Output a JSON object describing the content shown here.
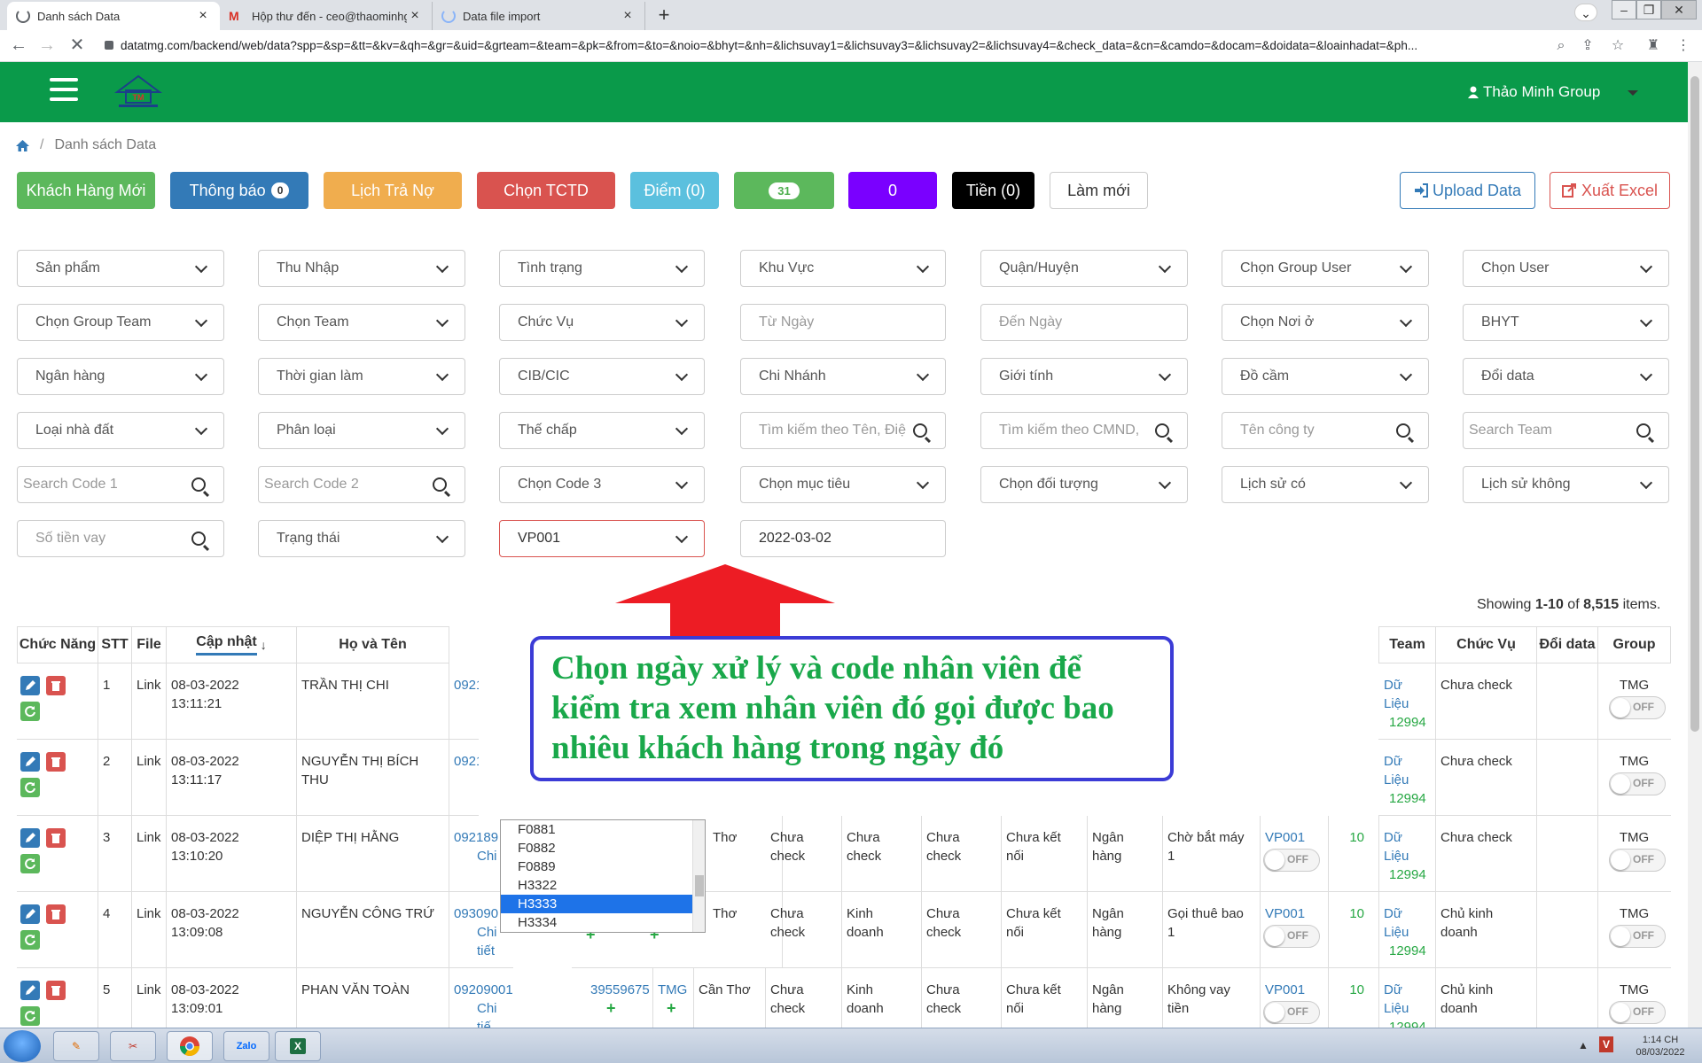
{
  "browser": {
    "tabs": [
      {
        "title": "Danh sách Data"
      },
      {
        "title": "Hộp thư đến - ceo@thaominhgro"
      },
      {
        "title": "Data file import"
      }
    ],
    "new_tab": "+",
    "url": "datatmg.com/backend/web/data?spp=&sp=&tt=&kv=&qh=&gr=&uid=&grteam=&team=&pk=&from=&to=&noio=&bhyt=&nh=&lichsuvay1=&lichsuvay3=&lichsuvay2=&lichsuvay4=&check_data=&cn=&camdo=&docam=&doidata=&loainhadat=&ph..."
  },
  "header": {
    "user_name": "Thảo Minh Group"
  },
  "breadcrumb": {
    "current": "Danh sách Data",
    "separator": "/"
  },
  "actions": {
    "new_customer": "Khách Hàng Mới",
    "notification": "Thông báo",
    "notification_count": "0",
    "payment_schedule": "Lịch Trả Nợ",
    "choose_tctd": "Chọn TCTD",
    "points": "Điểm (0)",
    "green_count": "31",
    "purple_count": "0",
    "money": "Tiền (0)",
    "refresh": "Làm mới",
    "upload": "Upload Data",
    "export": "Xuất Excel",
    "colors": {
      "green": "#5cb85c",
      "blue": "#337ab7",
      "orange": "#f0ad4e",
      "red": "#d9534f",
      "teal": "#5bc0de",
      "purple": "#7a00ff",
      "black": "#000000",
      "header_green": "#0a9a4a"
    }
  },
  "filters": {
    "r1": [
      "Sản phẩm",
      "Thu Nhập",
      "Tình trạng",
      "Khu Vực",
      "Quận/Huyện",
      "Chọn Group User",
      "Chọn User"
    ],
    "r2": [
      "Chọn Group Team",
      "Chọn Team",
      "Chức Vụ",
      "Từ Ngày",
      "Đến Ngày",
      "Chọn Nơi ở",
      "BHYT"
    ],
    "r3": [
      "Ngân hàng",
      "Thời gian làm",
      "CIB/CIC",
      "Chi Nhánh",
      "Giới tính",
      "Đồ cầm",
      "Đổi data"
    ],
    "r4": [
      "Loại nhà đất",
      "Phân loại",
      "Thế chấp",
      "Tìm kiếm theo Tên, Điệ",
      "Tìm kiếm theo CMND,",
      "Tên công ty",
      "Search Team"
    ],
    "r5": [
      "Search Code 1",
      "Search Code 2",
      "Chọn Code 3",
      "Chọn mục tiêu",
      "Chọn đối tượng",
      "Lịch sử có",
      "Lịch sử không"
    ],
    "r6": [
      "Số tiền vay",
      "Trạng thái",
      "VP001",
      "2022-03-02"
    ]
  },
  "summary": {
    "showing_prefix": "Showing ",
    "range": "1-10",
    "of": " of ",
    "total": "8,515",
    "suffix": " items."
  },
  "annotation": {
    "text": "Chọn ngày xử lý và code nhân viên để kiểm tra xem nhân viên đó gọi được bao nhiêu khách hàng trong ngày đó"
  },
  "table": {
    "headers": {
      "actions": "Chức Năng",
      "stt": "STT",
      "file": "File",
      "updated": "Cập nhật",
      "name": "Họ và Tên",
      "team": "Team",
      "position": "Chức Vụ",
      "change": "Đổi data",
      "group": "Group"
    },
    "rows": [
      {
        "stt": "1",
        "file": "Link",
        "date": "08-03-2022",
        "time": "13:11:21",
        "name": "TRẦN THỊ CHI",
        "phone": "0921",
        "team1": "Dữ",
        "team2": "Liệu",
        "team3": "12994",
        "position": "Chưa check",
        "group": "TMG"
      },
      {
        "stt": "2",
        "file": "Link",
        "date": "08-03-2022",
        "time": "13:11:17",
        "name": "NGUYỄN THỊ BÍCH",
        "name2": "THU",
        "phone": "0921",
        "team1": "Dữ",
        "team2": "Liệu",
        "team3": "12994",
        "position": "Chưa check",
        "group": "TMG"
      },
      {
        "stt": "3",
        "file": "Link",
        "date": "08-03-2022",
        "time": "13:10:20",
        "name": "DIỆP THỊ HẰNG",
        "phone": "092189",
        "detail": "Chi",
        "city": "Thơ",
        "c1": "Chưa",
        "c1b": "check",
        "c2": "Chưa",
        "c2b": "check",
        "c3": "Chưa",
        "c3b": "check",
        "c4": "Chưa kết",
        "c4b": "nối",
        "bank": "Ngân",
        "bankb": "hàng",
        "status": "Chờ bắt máy",
        "statusb": "1",
        "code": "VP001",
        "score": "10",
        "team1": "Dữ",
        "team2": "Liệu",
        "team3": "12994",
        "position": "Chưa check",
        "group": "TMG"
      },
      {
        "stt": "4",
        "file": "Link",
        "date": "08-03-2022",
        "time": "13:09:08",
        "name": "NGUYỄN CÔNG TRỨ",
        "phone": "093090",
        "detail": "Chi tiết",
        "city": "Thơ",
        "c1": "Chưa",
        "c1b": "check",
        "c2": "Kinh",
        "c2b": "doanh",
        "c3": "Chưa",
        "c3b": "check",
        "c4": "Chưa kết",
        "c4b": "nối",
        "bank": "Ngân",
        "bankb": "hàng",
        "status": "Gọi thuê bao",
        "statusb": "1",
        "code": "VP001",
        "score": "10",
        "team1": "Dữ",
        "team2": "Liệu",
        "team3": "12994",
        "position": "Chủ kinh",
        "position2": "doanh",
        "group": "TMG"
      },
      {
        "stt": "5",
        "file": "Link",
        "date": "08-03-2022",
        "time": "13:09:01",
        "name": "PHAN VĂN TOÀN",
        "phone": "09209001",
        "phone2": "39559675",
        "tmg": "TMG",
        "detail": "Chi tiế",
        "city": "Cần Thơ",
        "c1": "Chưa",
        "c1b": "check",
        "c2": "Kinh",
        "c2b": "doanh",
        "c3": "Chưa",
        "c3b": "check",
        "c4": "Chưa kết",
        "c4b": "nối",
        "bank": "Ngân",
        "bankb": "hàng",
        "status": "Không vay",
        "statusb": "tiền",
        "code": "VP001",
        "score": "10",
        "team1": "Dữ",
        "team2": "Liệu",
        "team3": "12994",
        "position": "Chủ kinh",
        "position2": "doanh",
        "group": "TMG"
      }
    ],
    "toggle_off": "OFF",
    "plus": "+"
  },
  "dropdown": {
    "options": [
      "F0881",
      "F0882",
      "F0889",
      "H3322",
      "H3333",
      "H3334"
    ],
    "selected": "H3333"
  },
  "taskbar": {
    "clock_time": "1:14 CH",
    "clock_date": "08/03/2022",
    "apps": [
      "Zalo"
    ]
  }
}
